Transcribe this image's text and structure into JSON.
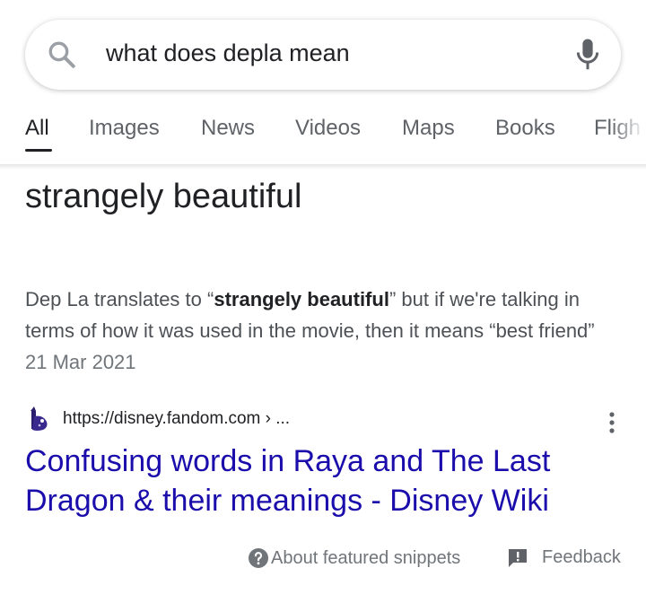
{
  "search": {
    "query": "what does depla mean",
    "icon": "search-icon",
    "mic_icon": "mic-icon"
  },
  "tabs": [
    {
      "label": "All",
      "active": true
    },
    {
      "label": "Images"
    },
    {
      "label": "News"
    },
    {
      "label": "Videos"
    },
    {
      "label": "Maps"
    },
    {
      "label": "Books"
    },
    {
      "label": "Fligh"
    }
  ],
  "featured": {
    "answer": "strangely beautiful",
    "snippet": {
      "part1": "Dep La translates to “",
      "bold": "strangely beautiful",
      "part2": "” but if we're talking in terms of how it was used in the movie, then it means “best friend”",
      "date": "21 Mar 2021"
    },
    "source": {
      "url": "https://disney.fandom.com › ...",
      "favicon": "disney-fandom-favicon"
    },
    "title": "Confusing words in Raya and The Last Dragon & their meanings - Disney Wiki"
  },
  "footer": {
    "about": "About featured snippets",
    "feedback": "Feedback"
  },
  "colors": {
    "link": "#1a0dab",
    "secondary_text": "#70757a",
    "snippet_text": "#4d5156"
  }
}
